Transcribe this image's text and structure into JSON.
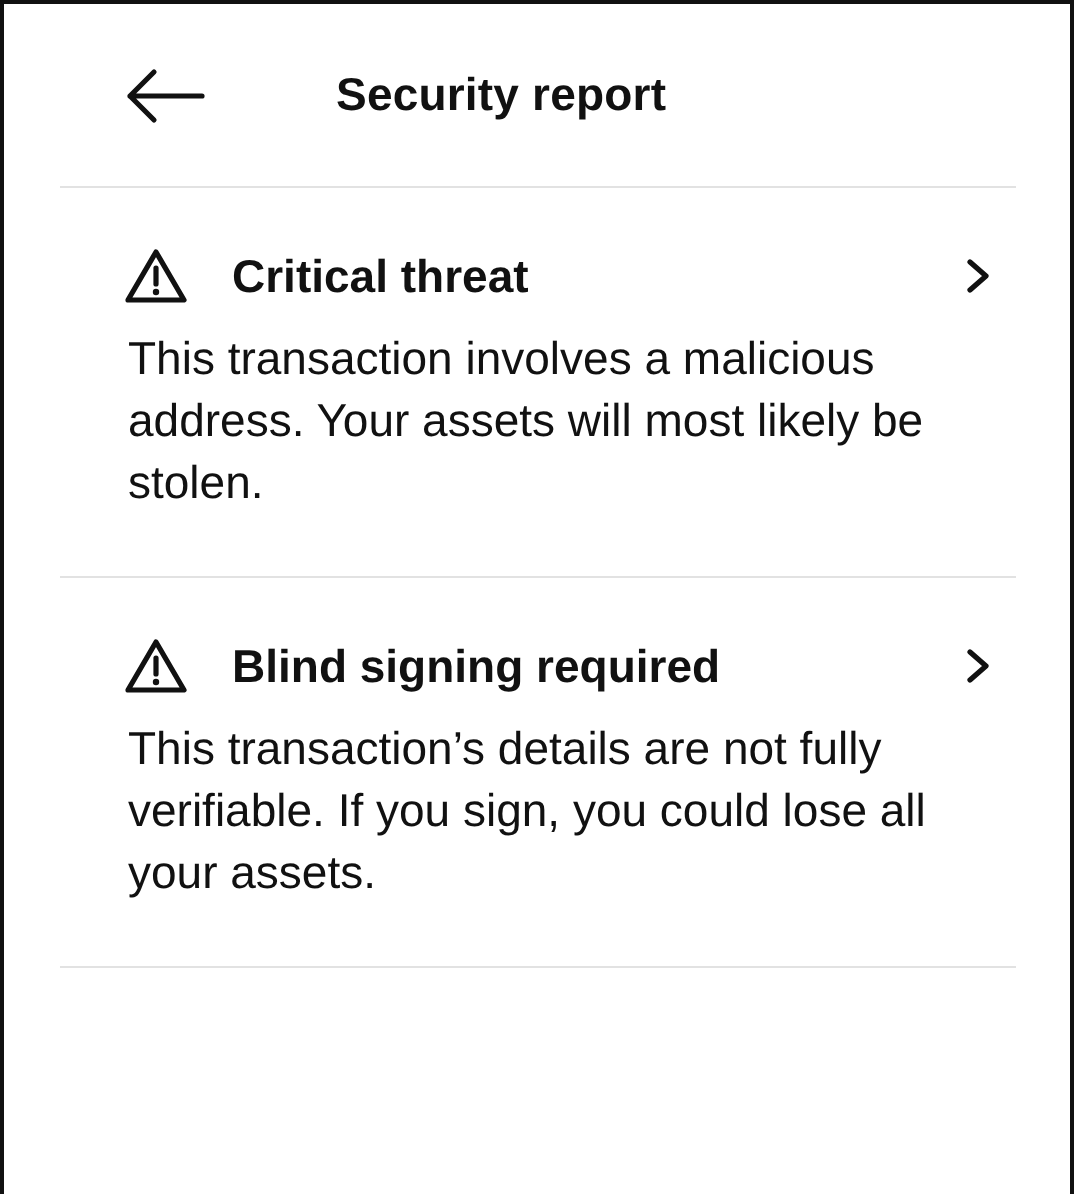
{
  "header": {
    "title": "Security report"
  },
  "warnings": [
    {
      "title": "Critical threat",
      "description": "This transaction involves a malicious address. Your assets will most likely be stolen."
    },
    {
      "title": "Blind signing required",
      "description": "This transaction’s details are not fully verifiable. If you sign, you could lose all your assets."
    }
  ]
}
